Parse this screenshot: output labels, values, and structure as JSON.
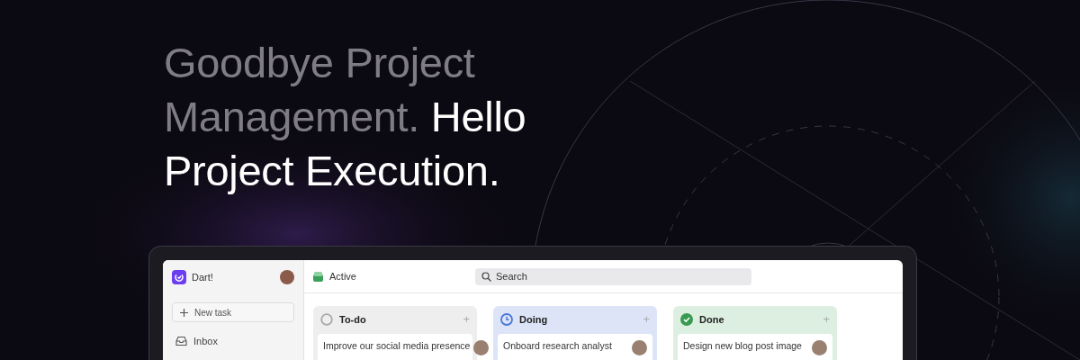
{
  "headline": {
    "muted": "Goodbye Project Management.",
    "bright": "Hello Project Execution."
  },
  "sidebar": {
    "workspace": "Dart!",
    "new_task": "New task",
    "items": [
      {
        "label": "Inbox"
      }
    ]
  },
  "header": {
    "view": "Active",
    "search": {
      "placeholder": "Search"
    }
  },
  "columns": [
    {
      "kind": "todo",
      "title": "To-do",
      "add": "+",
      "cards": [
        {
          "title": "Improve our social media presence"
        }
      ]
    },
    {
      "kind": "doing",
      "title": "Doing",
      "add": "+",
      "cards": [
        {
          "title": "Onboard research analyst"
        }
      ]
    },
    {
      "kind": "done",
      "title": "Done",
      "add": "+",
      "cards": [
        {
          "title": "Design new blog post image"
        }
      ]
    }
  ]
}
